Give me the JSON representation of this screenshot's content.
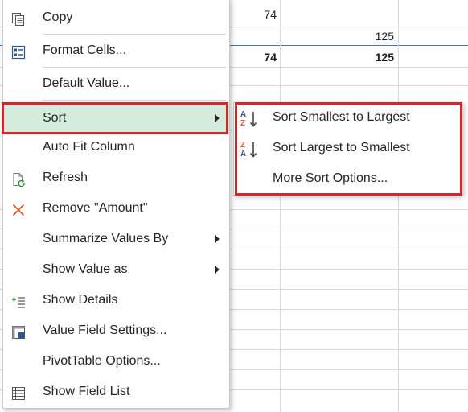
{
  "sheet": {
    "cells": {
      "row1_value": "74",
      "row2_value": "125",
      "total_a": "74",
      "total_b": "125"
    }
  },
  "context_menu": {
    "items": [
      {
        "label": "Copy",
        "icon": "copy-icon"
      },
      {
        "label": "Format Cells...",
        "icon": "format-cells-icon"
      },
      {
        "label": "Default Value..."
      },
      {
        "label": "Sort",
        "has_submenu": true,
        "highlighted": true
      },
      {
        "label": "Auto Fit Column"
      },
      {
        "label": "Refresh",
        "icon": "refresh-icon"
      },
      {
        "label": "Remove \"Amount\"",
        "icon": "remove-icon"
      },
      {
        "label": "Summarize Values By",
        "has_submenu": true
      },
      {
        "label": "Show Value as",
        "has_submenu": true
      },
      {
        "label": "Show Details",
        "icon": "show-details-icon"
      },
      {
        "label": "Value Field Settings...",
        "icon": "value-field-settings-icon"
      },
      {
        "label": "PivotTable Options..."
      },
      {
        "label": "Show Field List",
        "icon": "field-list-icon"
      }
    ]
  },
  "sort_submenu": {
    "items": [
      {
        "label": "Sort Smallest to Largest",
        "icon": "sort-ascending-icon"
      },
      {
        "label": "Sort Largest to Smallest",
        "icon": "sort-descending-icon"
      },
      {
        "label": "More Sort Options..."
      }
    ]
  },
  "colors": {
    "highlight_border": "#d9242b",
    "sort_item_background": "#d3ecdb",
    "total_line": "#4472c4"
  }
}
